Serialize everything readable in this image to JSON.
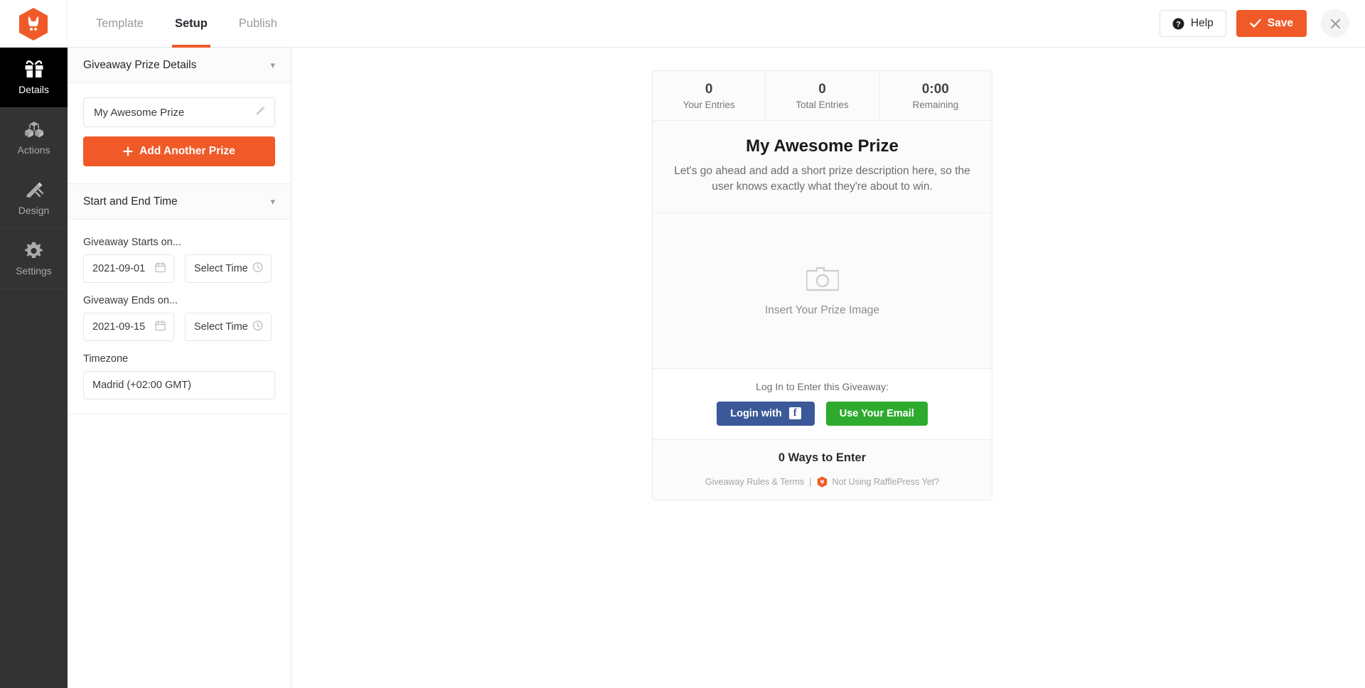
{
  "topbar": {
    "logo_icon": "rafflepress-bunny-logo",
    "tabs": [
      {
        "label": "Template",
        "active": false
      },
      {
        "label": "Setup",
        "active": true
      },
      {
        "label": "Publish",
        "active": false
      }
    ],
    "help_label": "Help",
    "help_icon": "question-circle-icon",
    "save_label": "Save",
    "save_icon": "check-icon",
    "close_icon": "close-icon",
    "accent_color": "#f05a28"
  },
  "rail": {
    "items": [
      {
        "label": "Details",
        "icon": "gift-icon",
        "active": true
      },
      {
        "label": "Actions",
        "icon": "cubes-icon",
        "active": false
      },
      {
        "label": "Design",
        "icon": "pencil-ruler-icon",
        "active": false
      },
      {
        "label": "Settings",
        "icon": "gear-icon",
        "active": false
      }
    ]
  },
  "panel": {
    "prize_section": {
      "title": "Giveaway Prize Details",
      "chevron": "chevron-down-icon",
      "prize_name": "My Awesome Prize",
      "prize_edit_icon": "pencil-icon",
      "add_prize_label": "Add Another Prize",
      "add_prize_icon": "plus-icon"
    },
    "time_section": {
      "title": "Start and End Time",
      "chevron": "chevron-down-icon",
      "start_label": "Giveaway Starts on...",
      "start_date": "2021-09-01",
      "start_time_placeholder": "Select Time",
      "end_label": "Giveaway Ends on...",
      "end_date": "2021-09-15",
      "end_time_placeholder": "Select Time",
      "calendar_icon": "calendar-icon",
      "clock_icon": "clock-icon",
      "timezone_label": "Timezone",
      "timezone_value": "Madrid (+02:00 GMT)"
    }
  },
  "preview": {
    "stats": [
      {
        "value": "0",
        "label": "Your Entries"
      },
      {
        "value": "0",
        "label": "Total Entries"
      },
      {
        "value": "0:00",
        "label": "Remaining"
      }
    ],
    "prize_title": "My Awesome Prize",
    "prize_description": "Let's go ahead and add a short prize description here, so the user knows exactly what they're about to win.",
    "image_placeholder_text": "Insert Your Prize Image",
    "image_placeholder_icon": "camera-icon",
    "login_label": "Log In to Enter this Giveaway:",
    "facebook_label": "Login with",
    "facebook_icon": "facebook-icon",
    "facebook_color": "#3b5998",
    "email_label": "Use Your Email",
    "email_color": "#2eab2e",
    "ways_to_enter": "0 Ways to Enter",
    "footer_rules": "Giveaway Rules & Terms",
    "footer_separator": "|",
    "footer_logo_icon": "rafflepress-bunny-logo",
    "footer_promo": "Not Using RafflePress Yet?"
  }
}
